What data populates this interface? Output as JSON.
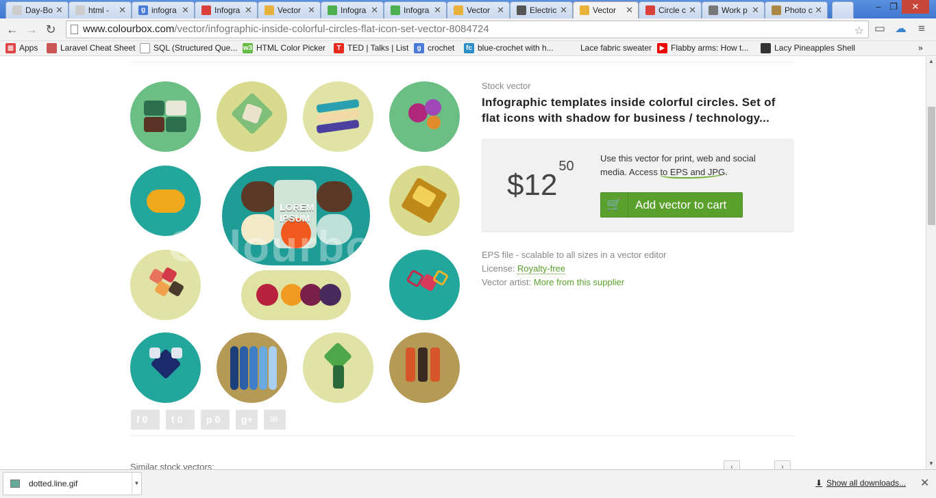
{
  "browser": {
    "tabs": [
      {
        "label": "Day-Bo",
        "icon": "page-icon",
        "color": "#cccccc"
      },
      {
        "label": "html -",
        "icon": "page-icon",
        "color": "#cccccc"
      },
      {
        "label": "infogra",
        "icon": "google-icon",
        "color": "#4a7bd8"
      },
      {
        "label": "Infogra",
        "icon": "red-favicon-icon",
        "color": "#d9403a"
      },
      {
        "label": "Vector",
        "icon": "colourbox-icon",
        "color": "#e8b23a"
      },
      {
        "label": "Infogra",
        "icon": "green-favicon-icon",
        "color": "#4caf50"
      },
      {
        "label": "Infogra",
        "icon": "green-favicon-icon",
        "color": "#4caf50"
      },
      {
        "label": "Vector",
        "icon": "colourbox-icon",
        "color": "#e8b23a"
      },
      {
        "label": "Electric",
        "icon": "site-icon",
        "color": "#555555"
      },
      {
        "label": "Vector",
        "icon": "colourbox-icon",
        "color": "#e8b23a"
      },
      {
        "label": "Circle c",
        "icon": "red-favicon-icon",
        "color": "#d9403a"
      },
      {
        "label": "Work p",
        "icon": "site-icon",
        "color": "#777777"
      },
      {
        "label": "Photo c",
        "icon": "pencil-icon",
        "color": "#aa8844"
      }
    ],
    "active_tab_index": 9,
    "url_host": "www.colourbox.com",
    "url_path": "/vector/infographic-inside-colorful-circles-flat-icon-set-vector-8084724",
    "bookmarks": [
      {
        "label": "Apps",
        "icon": "apps-grid-icon"
      },
      {
        "label": "Laravel Cheat Sheet",
        "icon": "laravel-icon"
      },
      {
        "label": "SQL (Structured Que...",
        "icon": "page-icon"
      },
      {
        "label": "HTML Color Picker",
        "icon": "w3-icon"
      },
      {
        "label": "TED | Talks | List",
        "icon": "ted-icon"
      },
      {
        "label": "crochet",
        "icon": "google-icon"
      },
      {
        "label": "blue-crochet with h...",
        "icon": "fc-icon"
      },
      {
        "label": "Lace fabric sweater",
        "icon": "blank-icon"
      },
      {
        "label": "Flabby arms: How t...",
        "icon": "youtube-icon"
      },
      {
        "label": "Lacy Pineapples Shell",
        "icon": "site-icon"
      }
    ]
  },
  "product": {
    "kicker": "Stock vector",
    "title": "Infographic templates inside colorful circles. Set of flat icons with shadow for business / technology...",
    "price_dollars": "$12",
    "price_cents": "50",
    "usage_text_1": "Use this vector for print, web and social media. Access ",
    "usage_highlight": "to EPS and JPG.",
    "cart_label": "Add vector to cart",
    "file_info": "EPS file - scalable to all sizes in a vector editor",
    "license_label": "License: ",
    "license_value": "Royalty-free",
    "artist_label": "Vector artist: ",
    "artist_value": "More from this supplier",
    "lorem_text": "LOREM IPSUM",
    "watermark": "Colourbox"
  },
  "share": [
    {
      "name": "facebook",
      "glyph": "f",
      "count": "0"
    },
    {
      "name": "twitter",
      "glyph": "t",
      "count": "0"
    },
    {
      "name": "pinterest",
      "glyph": "p",
      "count": "0"
    },
    {
      "name": "google-plus",
      "glyph": "g+",
      "count": ""
    },
    {
      "name": "email",
      "glyph": "✉",
      "count": ""
    }
  ],
  "similar_label": "Similar stock vectors:",
  "downloads": {
    "file": "dotted.line.gif",
    "show_all": "Show all downloads..."
  },
  "colors": {
    "accent_green": "#5aa02c",
    "teal": "#23a69b",
    "olive": "#b49a55",
    "pale_yellow": "#d8db8e"
  }
}
